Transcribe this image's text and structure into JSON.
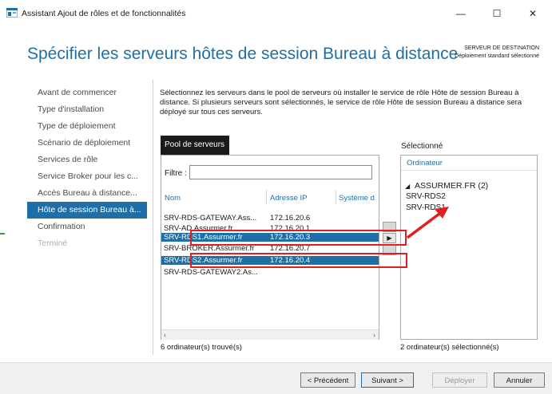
{
  "window": {
    "title": "Assistant Ajout de rôles et de fonctionnalités",
    "minimize": "—",
    "maximize": "☐",
    "close": "✕"
  },
  "header": {
    "title": "Spécifier les serveurs hôtes de session Bureau à distance",
    "destination_label": "SERVEUR DE DESTINATION",
    "destination_value": "Déploiement standard sélectionné"
  },
  "nav": {
    "items": [
      {
        "label": "Avant de commencer",
        "state": "normal"
      },
      {
        "label": "Type d'installation",
        "state": "normal"
      },
      {
        "label": "Type de déploiement",
        "state": "normal"
      },
      {
        "label": "Scénario de déploiement",
        "state": "normal"
      },
      {
        "label": "Services de rôle",
        "state": "normal"
      },
      {
        "label": "Service Broker pour les c...",
        "state": "normal"
      },
      {
        "label": "Accès Bureau à distance...",
        "state": "normal"
      },
      {
        "label": "Hôte de session Bureau à...",
        "state": "active"
      },
      {
        "label": "Confirmation",
        "state": "normal"
      },
      {
        "label": "Terminé",
        "state": "disabled"
      }
    ]
  },
  "main": {
    "description": "Sélectionnez les serveurs dans le pool de serveurs où installer le service de rôle Hôte de session Bureau à distance. Si plusieurs serveurs sont sélectionnés, le service de rôle Hôte de session Bureau à distance sera déployé sur tous ces serveurs.",
    "pool_tab": "Pool de serveurs",
    "filter_label": "Filtre :",
    "filter_value": "",
    "columns": [
      "Nom",
      "Adresse IP",
      "Système d"
    ],
    "rows": [
      {
        "name": "SRV-RDS-GATEWAY.Ass...",
        "ip": "172.16.20.6",
        "selected": false
      },
      {
        "name": "SRV-AD.Assurmer.fr",
        "ip": "172.16.20.1",
        "selected": false
      },
      {
        "name": "SRV-RDS1.Assurmer.fr",
        "ip": "172.16.20.3",
        "selected": true
      },
      {
        "name": "SRV-BROKER.Assurmer.fr",
        "ip": "172.16.20.7",
        "selected": false
      },
      {
        "name": "SRV-RDS2.Assurmer.fr",
        "ip": "172.16.20.4",
        "selected": true
      },
      {
        "name": "SRV-RDS-GATEWAY2.As...",
        "ip": "",
        "selected": false
      }
    ],
    "found_count": "6 ordinateur(s) trouvé(s)",
    "move_right": "▶",
    "scroll_left": "‹",
    "scroll_right": "›"
  },
  "selected": {
    "label": "Sélectionné",
    "column": "Ordinateur",
    "group": "ASSURMER.FR (2)",
    "group_arrow": "◢",
    "items": [
      "SRV-RDS2",
      "SRV-RDS1"
    ],
    "count": "2 ordinateur(s) sélectionné(s)"
  },
  "footer": {
    "previous": "< Précédent",
    "next": "Suivant >",
    "deploy": "Déployer",
    "cancel": "Annuler"
  },
  "colors": {
    "accent": "#1e6fa8",
    "annotation": "#e02020"
  }
}
